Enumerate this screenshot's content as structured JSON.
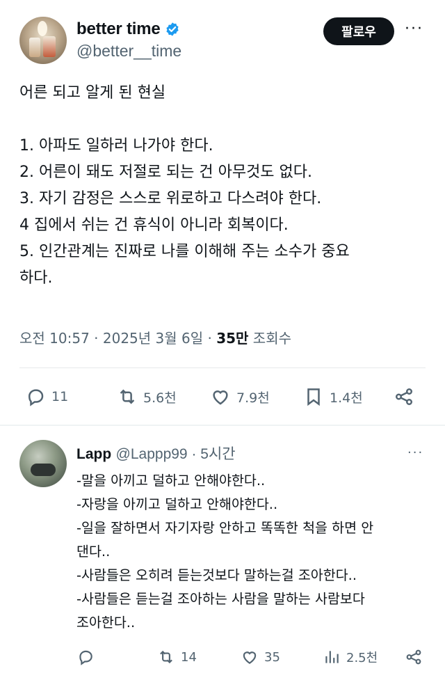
{
  "tweet": {
    "display_name": "better time",
    "handle": "@better__time",
    "follow_label": "팔로우",
    "more_label": "···",
    "title_line": "어른 되고 알게 된 현실",
    "lines": [
      "1. 아파도 일하러 나가야 한다.",
      "2. 어른이 돼도 저절로 되는 건 아무것도 없다.",
      "3. 자기 감정은 스스로 위로하고 다스려야 한다.",
      "4 집에서 쉬는 건 휴식이 아니라 회복이다.",
      "5. 인간관계는 진짜로 나를 이해해 주는 소수가 중요",
      "하다."
    ],
    "meta": {
      "time": "오전 10:57 · 2025년 3월 6일 · ",
      "views_count": "35만",
      "views_label": " 조회수"
    },
    "actions": {
      "replies": "11",
      "retweets": "5.6천",
      "likes": "7.9천",
      "bookmarks": "1.4천"
    },
    "verified_color": "#1d9bf0"
  },
  "reply": {
    "display_name": "Lapp",
    "handle": "@Lappp99 · 5시간",
    "more_label": "···",
    "lines": [
      "-말을 아끼고 덜하고 안해야한다..",
      "-자랑을 아끼고 덜하고 안해야한다..",
      "-일을 잘하면서 자기자랑 안하고 똑똑한 척을 하면 안",
      "댄다..",
      "-사람들은 오히려 듣는것보다 말하는걸 조아한다..",
      "-사람들은 듣는걸 조아하는 사람을 말하는 사람보다",
      "조아한다.."
    ],
    "actions": {
      "replies": "",
      "retweets": "14",
      "likes": "35",
      "views": "2.5천"
    }
  }
}
